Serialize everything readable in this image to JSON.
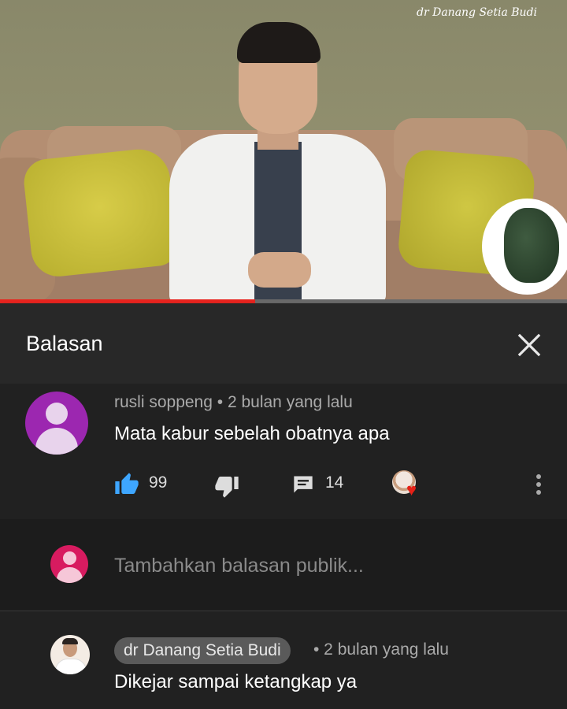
{
  "video": {
    "watermark": "dr Danang Setia Budi",
    "progress_fraction": 0.45
  },
  "header": {
    "title": "Balasan",
    "close_icon": "close-icon"
  },
  "comment": {
    "author": "rusli soppeng",
    "separator": "•",
    "time": "2 bulan yang lalu",
    "text": "Mata kabur sebelah obatnya apa",
    "like_count": "99",
    "reply_count": "14",
    "hearted_by_creator": true
  },
  "reply_input": {
    "placeholder": "Tambahkan balasan publik..."
  },
  "reply": {
    "author": "dr Danang Setia Budi",
    "time": "• 2 bulan yang lalu",
    "text": "Dikejar sampai ketangkap ya"
  },
  "colors": {
    "accent_blue": "#3ea6ff",
    "progress_red": "#e8241f",
    "heart_red": "#e62117"
  }
}
